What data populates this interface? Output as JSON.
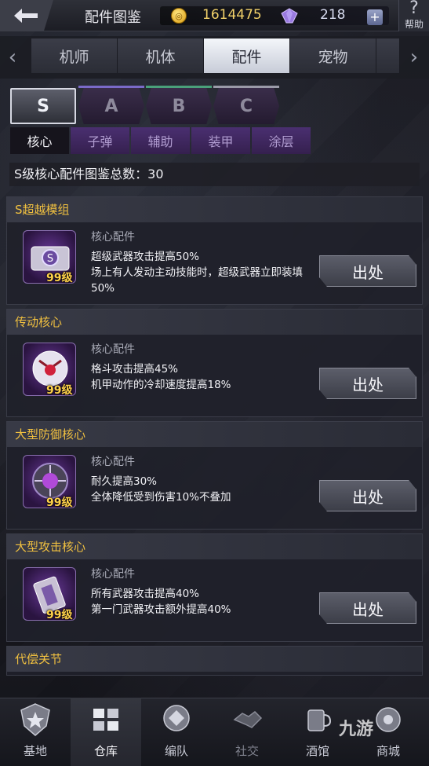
{
  "header": {
    "title": "配件图鉴",
    "coins": "1614475",
    "gems": "218",
    "help_label": "帮助"
  },
  "category_tabs": [
    {
      "label": "机师"
    },
    {
      "label": "机体"
    },
    {
      "label": "配件"
    },
    {
      "label": "宠物"
    }
  ],
  "rank_tabs": [
    {
      "label": "S"
    },
    {
      "label": "A"
    },
    {
      "label": "B"
    },
    {
      "label": "C"
    }
  ],
  "sub_tabs": [
    {
      "label": "核心"
    },
    {
      "label": "子弹"
    },
    {
      "label": "辅助"
    },
    {
      "label": "装甲"
    },
    {
      "label": "涂层"
    }
  ],
  "total_line": "S级核心配件图鉴总数：30",
  "parts": [
    {
      "name": "S超越模组",
      "type": "核心配件",
      "level": "99级",
      "desc": "超级武器攻击提高50%\n场上有人发动主动技能时，超级武器立即装填50%",
      "button": "出处"
    },
    {
      "name": "传动核心",
      "type": "核心配件",
      "level": "99级",
      "desc": "格斗攻击提高45%\n机甲动作的冷却速度提高18%",
      "button": "出处"
    },
    {
      "name": "大型防御核心",
      "type": "核心配件",
      "level": "99级",
      "desc": "耐久提高30%\n全体降低受到伤害10%不叠加",
      "button": "出处"
    },
    {
      "name": "大型攻击核心",
      "type": "核心配件",
      "level": "99级",
      "desc": "所有武器攻击提高40%\n第一门武器攻击额外提高40%",
      "button": "出处"
    }
  ],
  "partial_part": {
    "name": "代偿关节"
  },
  "bottom_nav": [
    {
      "label": "基地",
      "icon": "base-icon"
    },
    {
      "label": "仓库",
      "icon": "warehouse-icon"
    },
    {
      "label": "编队",
      "icon": "formation-icon"
    },
    {
      "label": "社交",
      "icon": "social-icon"
    },
    {
      "label": "酒馆",
      "icon": "tavern-icon"
    },
    {
      "label": "商城",
      "icon": "shop-icon"
    }
  ],
  "watermark": "九游",
  "colors": {
    "gold": "#f0c040",
    "level_gold": "#ffd24a",
    "purple_tab": "#4a2f70"
  }
}
